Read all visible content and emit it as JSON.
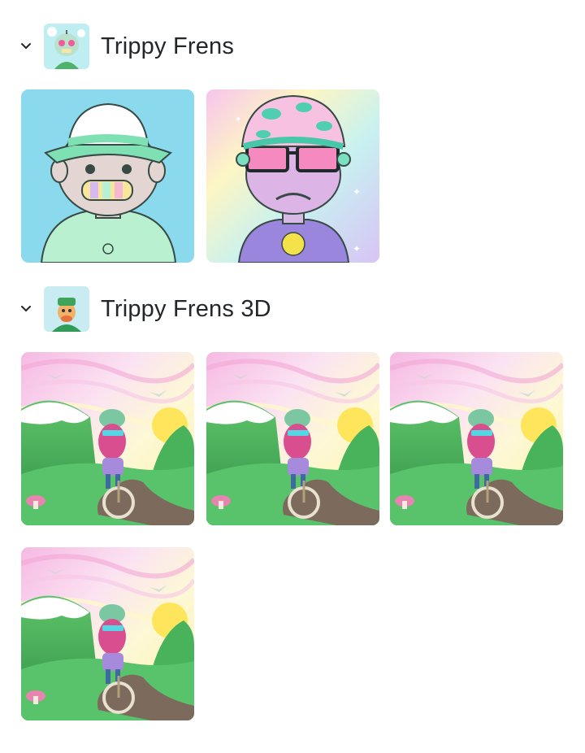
{
  "collections": [
    {
      "title": "Trippy Frens",
      "expanded": true,
      "avatar_icon": "trippy-fren-avatar",
      "items": [
        {
          "name": "bucket-hat-fren-nft",
          "background": "#8ad9ec"
        },
        {
          "name": "mushroom-hat-fren-nft",
          "background": "#e9c7f0"
        }
      ]
    },
    {
      "title": "Trippy Frens 3D",
      "expanded": true,
      "avatar_icon": "trippy-fren-3d-avatar",
      "items": [
        {
          "name": "unicycle-fren-3d-nft"
        },
        {
          "name": "unicycle-fren-3d-nft"
        },
        {
          "name": "unicycle-fren-3d-nft"
        },
        {
          "name": "unicycle-fren-3d-nft"
        }
      ]
    }
  ],
  "colors": {
    "text": "#24272a",
    "background": "#ffffff"
  }
}
